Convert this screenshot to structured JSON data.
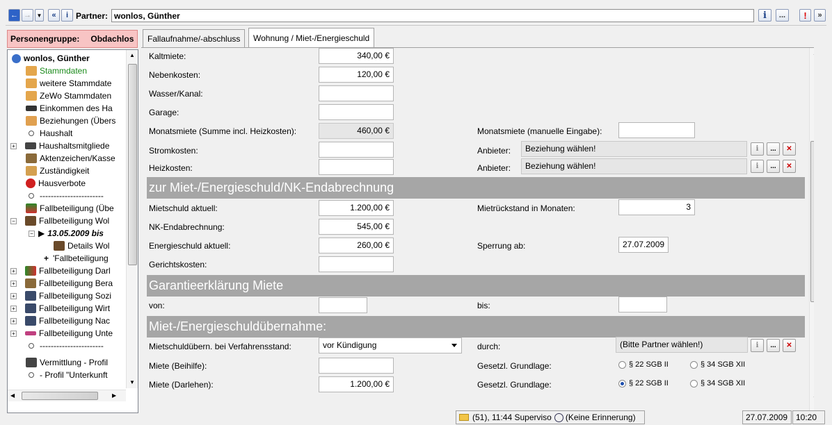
{
  "toolbar": {
    "partner_label": "Partner:",
    "partner_value": "wonlos, Günther",
    "info_btn": "i",
    "more_btn": "...",
    "alert_btn": "!",
    "expand_btn": "»"
  },
  "personengruppe": {
    "label": "Personengruppe:",
    "value": "Obdachlos"
  },
  "tabs": [
    {
      "label": "Fallaufnahme/-abschluss"
    },
    {
      "label": "Wohnung / Miet-/Energieschuld"
    }
  ],
  "tree": {
    "items": [
      {
        "label": "wonlos, Günther",
        "bold": true
      },
      {
        "label": "Stammdaten",
        "color": "#1a8a1a"
      },
      {
        "label": "weitere Stammdate"
      },
      {
        "label": "ZeWo Stammdaten"
      },
      {
        "label": "Einkommen des Ha"
      },
      {
        "label": "Beziehungen (Übers"
      },
      {
        "label": "Haushalt"
      },
      {
        "label": "Haushaltsmitgliede"
      },
      {
        "label": "Aktenzeichen/Kasse"
      },
      {
        "label": "Zuständigkeit"
      },
      {
        "label": "Hausverbote"
      },
      {
        "label": "-----------------------"
      },
      {
        "label": "Fallbeteiligung (Übe"
      },
      {
        "label": "Fallbeteiligung Wol"
      },
      {
        "label": "13.05.2009 bis",
        "bold": true,
        "italic": true
      },
      {
        "label": "Details Wol"
      },
      {
        "label": "'Fallbeteiligung"
      },
      {
        "label": "Fallbeteiligung Darl"
      },
      {
        "label": "Fallbeteiligung Bera"
      },
      {
        "label": "Fallbeteiligung Sozi"
      },
      {
        "label": "Fallbeteiligung Wirt"
      },
      {
        "label": "Fallbeteiligung Nac"
      },
      {
        "label": "Fallbeteiligung Unte"
      },
      {
        "label": "-----------------------"
      },
      {
        "label": "Vermittlung - Profil"
      },
      {
        "label": "- Profil \"Unterkunft"
      }
    ]
  },
  "form": {
    "kaltmiete": {
      "label": "Kaltmiete:",
      "value": "340,00 €"
    },
    "nebenkosten": {
      "label": "Nebenkosten:",
      "value": "120,00 €"
    },
    "wasser": {
      "label": "Wasser/Kanal:",
      "value": ""
    },
    "garage": {
      "label": "Garage:",
      "value": ""
    },
    "monatsmiete": {
      "label": "Monatsmiete (Summe incl. Heizkosten):",
      "value": "460,00 €"
    },
    "monatsmiete_manuell": {
      "label": "Monatsmiete (manuelle Eingabe):",
      "value": ""
    },
    "stromkosten": {
      "label": "Stromkosten:",
      "value": ""
    },
    "heizkosten": {
      "label": "Heizkosten:",
      "value": ""
    },
    "anbieter1": {
      "label": "Anbieter:",
      "value": "Beziehung wählen!"
    },
    "anbieter2": {
      "label": "Anbieter:",
      "value": "Beziehung wählen!"
    },
    "section1": "zur Miet-/Energieschuld/NK-Endabrechnung",
    "mietschuld": {
      "label": "Mietschuld aktuell:",
      "value": "1.200,00 €"
    },
    "mietrueckstand": {
      "label": "Mietrückstand in Monaten:",
      "value": "3"
    },
    "nk_end": {
      "label": "NK-Endabrechnung:",
      "value": "545,00 €"
    },
    "energieschuld": {
      "label": "Energieschuld aktuell:",
      "value": "260,00 €"
    },
    "sperrung": {
      "label": "Sperrung ab:",
      "value": "27.07.2009"
    },
    "gerichtskosten": {
      "label": "Gerichtskosten:",
      "value": ""
    },
    "section2": "Garantieerklärung Miete",
    "von": {
      "label": "von:",
      "value": ""
    },
    "bis": {
      "label": "bis:",
      "value": ""
    },
    "section3": "Miet-/Energieschuldübernahme:",
    "verfahrensstand": {
      "label": "Mietschuldübern. bei Verfahrensstand:",
      "value": "vor Kündigung"
    },
    "durch": {
      "label": "durch:",
      "value": "(Bitte Partner wählen!)"
    },
    "miete_beihilfe": {
      "label": "Miete (Beihilfe):",
      "value": ""
    },
    "gesetz1": {
      "label": "Gesetzl. Grundlage:",
      "opt1": "§ 22 SGB II",
      "opt2": "§ 34 SGB XII"
    },
    "miete_darlehen": {
      "label": "Miete (Darlehen):",
      "value": "1.200,00 €"
    },
    "gesetz2": {
      "label": "Gesetzl. Grundlage:",
      "opt1": "§ 22 SGB II",
      "opt2": "§ 34 SGB XII"
    }
  },
  "statusbar": {
    "messages": "(51), 11:44 Superviso",
    "reminder": "(Keine Erinnerung)",
    "date": "27.07.2009",
    "time": "10:20"
  }
}
